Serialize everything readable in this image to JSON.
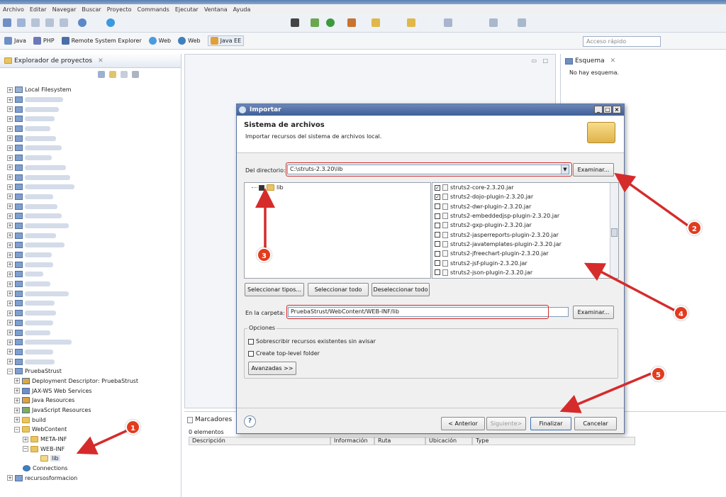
{
  "menubar": [
    "Archivo",
    "Editar",
    "Navegar",
    "Buscar",
    "Proyecto",
    "Commands",
    "Ejecutar",
    "Ventana",
    "Ayuda"
  ],
  "perspectives": [
    "Java",
    "PHP",
    "Remote System Explorer",
    "Web",
    "Web",
    "Java EE"
  ],
  "quick_access": "Acceso rápido",
  "explorer": {
    "title": "Explorador de proyectos",
    "close": "✕",
    "root": "Local Filesystem",
    "project": "PruebaStrust",
    "children": [
      "Deployment Descriptor: PruebaStrust",
      "JAX-WS Web Services",
      "Java Resources",
      "JavaScript Resources",
      "build",
      "WebContent"
    ],
    "webcontent_children": [
      "META-INF",
      "WEB-INF"
    ],
    "lib": "lib",
    "connections": "Connections",
    "last": "recursosformacion"
  },
  "outline": {
    "title": "Esquema",
    "empty": "No hay esquema."
  },
  "bookmarks": {
    "title": "Marcadores",
    "count": "0 elementos",
    "columns": [
      "Descripción",
      "Información",
      "Ruta",
      "Ubicación",
      "Type"
    ]
  },
  "dialog": {
    "title": "Importar",
    "heading": "Sistema de archivos",
    "subheading": "Importar recursos del sistema de archivos local.",
    "dir_label": "Del directorio:",
    "dir_value": "C:\\struts-2.3.20\\lib",
    "browse": "Examinar...",
    "folder_tree_item": "lib",
    "files": [
      {
        "name": "struts2-core-2.3.20.jar",
        "checked": true
      },
      {
        "name": "struts2-dojo-plugin-2.3.20.jar",
        "checked": true
      },
      {
        "name": "struts2-dwr-plugin-2.3.20.jar",
        "checked": false
      },
      {
        "name": "struts2-embeddedjsp-plugin-2.3.20.jar",
        "checked": false
      },
      {
        "name": "struts2-gxp-plugin-2.3.20.jar",
        "checked": false
      },
      {
        "name": "struts2-jasperreports-plugin-2.3.20.jar",
        "checked": false
      },
      {
        "name": "struts2-javatemplates-plugin-2.3.20.jar",
        "checked": false
      },
      {
        "name": "struts2-jfreechart-plugin-2.3.20.jar",
        "checked": false
      },
      {
        "name": "struts2-jsf-plugin-2.3.20.jar",
        "checked": false
      },
      {
        "name": "struts2-json-plugin-2.3.20.jar",
        "checked": false
      }
    ],
    "select_types": "Seleccionar tipos...",
    "select_all": "Seleccionar todo",
    "deselect_all": "Deseleccionar todo",
    "into_folder_label": "En la carpeta:",
    "into_folder_value": "PruebaStrust/WebContent/WEB-INF/lib",
    "browse2": "Examinar...",
    "options_label": "Opciones",
    "opt_overwrite": "Sobrescribir recursos existentes sin avisar",
    "opt_toplevel": "Create top-level folder",
    "advanced": "Avanzadas >>",
    "help": "?",
    "back": "< Anterior",
    "next": "Siguiente>",
    "finish": "Finalizar",
    "cancel": "Cancelar"
  },
  "annotations": [
    "1",
    "2",
    "3",
    "4",
    "5"
  ]
}
